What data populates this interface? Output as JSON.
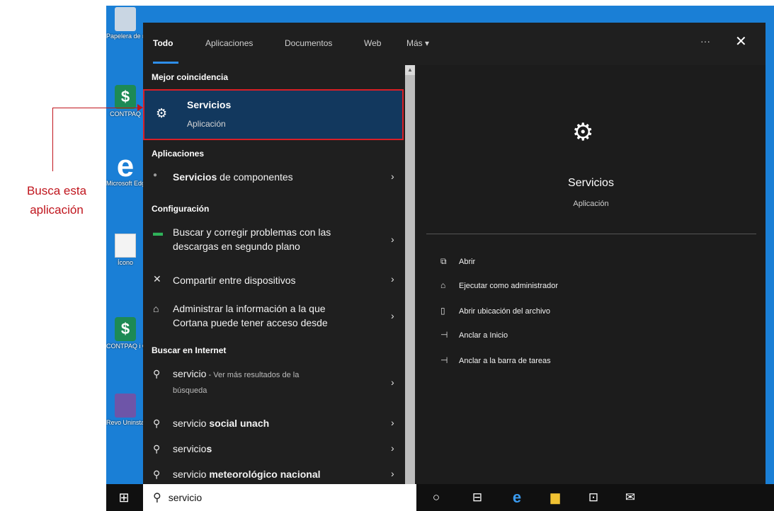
{
  "desktop": {
    "icons": [
      {
        "label": "Papelera de reciclaje"
      },
      {
        "label": "CONTPAQ"
      },
      {
        "label": "Microsoft Edge"
      },
      {
        "label": "Ícono"
      },
      {
        "label": "CONTPAQ i Comercial"
      },
      {
        "label": "Revo Uninstaller"
      }
    ]
  },
  "tabs": {
    "items": [
      "Todo",
      "Aplicaciones",
      "Documentos",
      "Web",
      "Más ▾"
    ],
    "more_label": "···",
    "close_label": "✕"
  },
  "results": {
    "best_match_header": "Mejor coincidencia",
    "best_match": {
      "name": "Servicios",
      "kind": "Aplicación"
    },
    "apps_header": "Aplicaciones",
    "apps": [
      {
        "bold": "Servicios",
        "rest": " de componentes"
      }
    ],
    "settings_header": "Configuración",
    "settings": [
      {
        "line1": "Buscar y corregir problemas con las",
        "line2": "descargas en segundo plano"
      },
      {
        "line1": "Compartir entre dispositivos",
        "line2": ""
      },
      {
        "line1": "Administrar la información a la que",
        "line2": "Cortana puede tener acceso desde"
      }
    ],
    "web_header": "Buscar en Internet",
    "web": [
      {
        "term": "servicio",
        "rest": " - Ver más resultados de la",
        "line2": "búsqueda"
      },
      {
        "term": "servicio",
        "bold": " social unach"
      },
      {
        "term": "servicio",
        "bold": "s"
      },
      {
        "term": "servicio",
        "bold": " meteorológico nacional"
      }
    ]
  },
  "preview": {
    "title": "Servicios",
    "kind": "Aplicación",
    "actions": [
      {
        "icon": "open-icon",
        "label": "Abrir"
      },
      {
        "icon": "admin-icon",
        "label": "Ejecutar como administrador"
      },
      {
        "icon": "folder-icon",
        "label": "Abrir ubicación del archivo"
      },
      {
        "icon": "pin-icon",
        "label": "Anclar a Inicio"
      },
      {
        "icon": "pin-icon",
        "label": "Anclar a la barra de tareas"
      }
    ]
  },
  "taskbar": {
    "search_value": "servicio"
  },
  "annotation": {
    "line1": "Busca esta",
    "line2": "aplicación",
    "color": "#c0151d"
  }
}
